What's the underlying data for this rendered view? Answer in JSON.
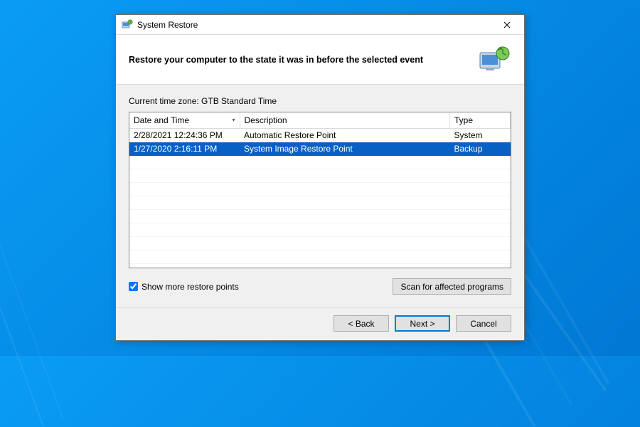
{
  "window": {
    "title": "System Restore"
  },
  "header": {
    "text": "Restore your computer to the state it was in before the selected event"
  },
  "timezone": {
    "label": "Current time zone: GTB Standard Time"
  },
  "table": {
    "columns": {
      "datetime": "Date and Time",
      "description": "Description",
      "type": "Type"
    },
    "rows": [
      {
        "datetime": "2/28/2021 12:24:36 PM",
        "description": "Automatic Restore Point",
        "type": "System",
        "selected": false
      },
      {
        "datetime": "1/27/2020 2:16:11 PM",
        "description": "System Image Restore Point",
        "type": "Backup",
        "selected": true
      }
    ]
  },
  "checkbox": {
    "label": "Show more restore points",
    "checked": true
  },
  "buttons": {
    "scan": "Scan for affected programs",
    "back": "< Back",
    "next": "Next >",
    "cancel": "Cancel"
  }
}
